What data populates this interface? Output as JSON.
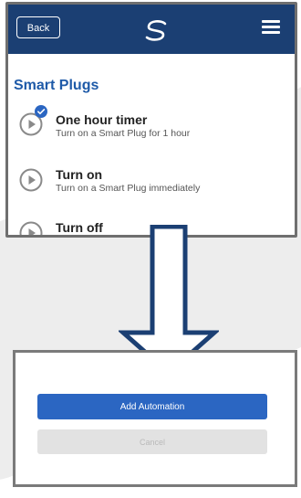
{
  "topbar": {
    "back_label": "Back",
    "logo_icon": "swirl-logo-icon",
    "menu_icon": "hamburger-menu-icon",
    "background": "#1b3f73"
  },
  "section": {
    "title": "Smart Plugs",
    "color": "#1e5aa8"
  },
  "items": [
    {
      "title": "One hour timer",
      "subtitle": "Turn on a Smart Plug for 1 hour",
      "icon": "play-circle-icon",
      "selected": true
    },
    {
      "title": "Turn on",
      "subtitle": "Turn on a Smart Plug immediately",
      "icon": "play-circle-icon",
      "selected": false
    },
    {
      "title": "Turn off",
      "subtitle": "",
      "icon": "play-circle-icon",
      "selected": false
    }
  ],
  "arrow": {
    "icon": "down-arrow-icon",
    "color": "#1b3f73"
  },
  "dialog": {
    "primary_label": "Add Automation",
    "secondary_label": "Cancel",
    "primary_color": "#2b66c2"
  }
}
